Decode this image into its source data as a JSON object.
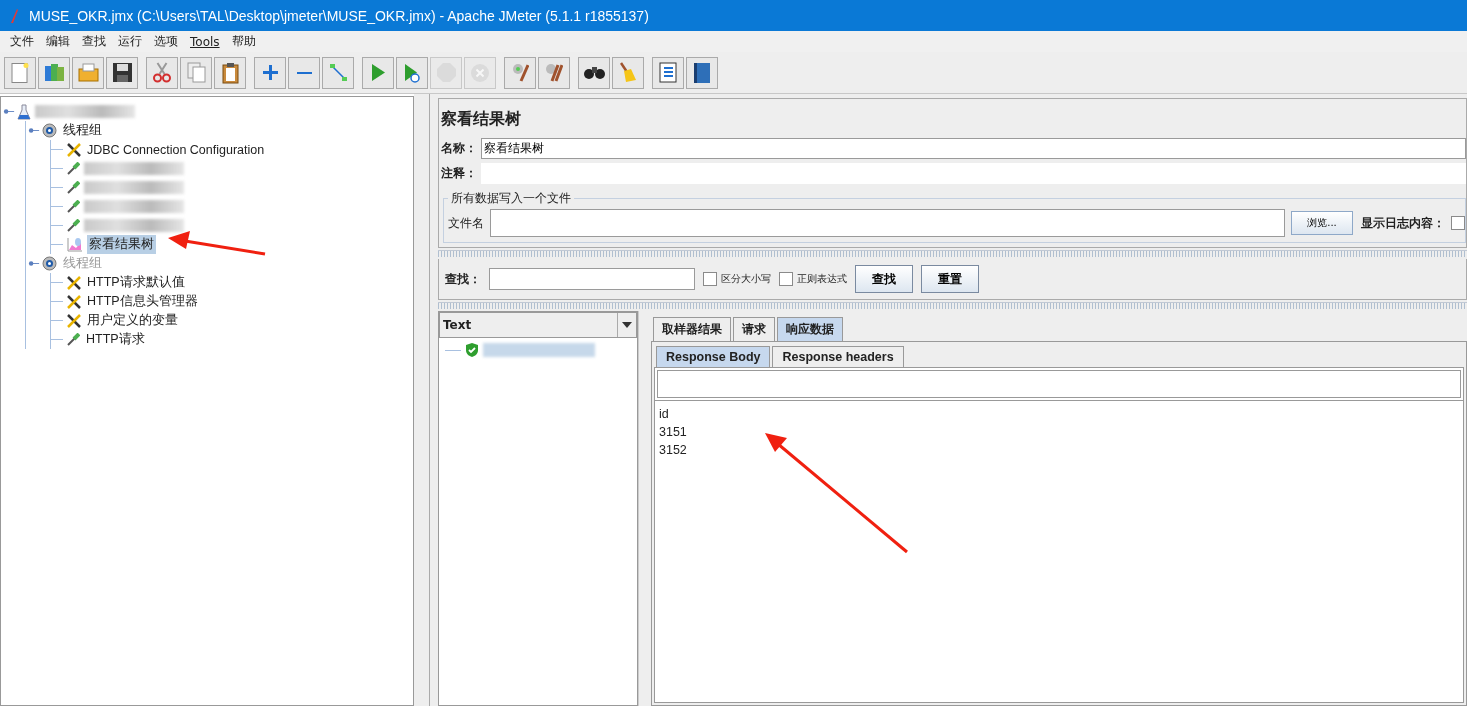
{
  "window": {
    "title": "MUSE_OKR.jmx (C:\\Users\\TAL\\Desktop\\jmeter\\MUSE_OKR.jmx) - Apache JMeter (5.1.1 r1855137)"
  },
  "menu": [
    {
      "label": "文件"
    },
    {
      "label": "编辑"
    },
    {
      "label": "查找"
    },
    {
      "label": "运行"
    },
    {
      "label": "选项"
    },
    {
      "label": "Tools",
      "underline": true
    },
    {
      "label": "帮助"
    }
  ],
  "toolbar": [
    [
      {
        "kind": "new",
        "disabled": false
      },
      {
        "kind": "templates",
        "disabled": false
      },
      {
        "kind": "open",
        "disabled": false
      },
      {
        "kind": "save",
        "disabled": false
      }
    ],
    [
      {
        "kind": "cut",
        "disabled": false
      },
      {
        "kind": "copy",
        "disabled": false
      },
      {
        "kind": "paste",
        "disabled": false
      }
    ],
    [
      {
        "kind": "plus",
        "disabled": false
      },
      {
        "kind": "minus",
        "disabled": false
      },
      {
        "kind": "toggle",
        "disabled": false
      }
    ],
    [
      {
        "kind": "start",
        "disabled": false
      },
      {
        "kind": "startnp",
        "disabled": false
      },
      {
        "kind": "stop",
        "disabled": true
      },
      {
        "kind": "shutdown",
        "disabled": true
      }
    ],
    [
      {
        "kind": "clear",
        "disabled": false
      },
      {
        "kind": "clearall",
        "disabled": false
      }
    ],
    [
      {
        "kind": "binoculars",
        "disabled": false
      },
      {
        "kind": "broom",
        "disabled": false
      }
    ],
    [
      {
        "kind": "list",
        "disabled": false
      },
      {
        "kind": "help",
        "disabled": false
      }
    ]
  ],
  "tree": [
    {
      "kind": "flask",
      "selected": false,
      "disabled": false,
      "expanded": true,
      "children": [
        {
          "kind": "gear",
          "label": "线程组",
          "selected": false,
          "disabled": false,
          "expanded": true,
          "children": [
            {
              "kind": "wrench",
              "label": "JDBC Connection Configuration",
              "selected": false,
              "disabled": false
            },
            {
              "kind": "pipette",
              "selected": false,
              "disabled": false
            },
            {
              "kind": "pipette",
              "selected": false,
              "disabled": false
            },
            {
              "kind": "pipette",
              "selected": false,
              "disabled": false
            },
            {
              "kind": "pipette",
              "selected": false,
              "disabled": false
            },
            {
              "kind": "graph",
              "label": "察看结果树",
              "selected": true,
              "disabled": false
            }
          ]
        },
        {
          "kind": "gear",
          "label": "线程组",
          "selected": false,
          "disabled": true,
          "expanded": true,
          "children": [
            {
              "kind": "wrench",
              "label": "HTTP请求默认值",
              "selected": false,
              "disabled": false
            },
            {
              "kind": "wrench",
              "label": "HTTP信息头管理器",
              "selected": false,
              "disabled": false
            },
            {
              "kind": "wrench",
              "label": "用户定义的变量",
              "selected": false,
              "disabled": false
            },
            {
              "kind": "pipette",
              "label": "HTTP请求",
              "selected": false,
              "disabled": false
            }
          ]
        }
      ]
    }
  ],
  "panel": {
    "title": "察看结果树",
    "name_label": "名称：",
    "name_value": "察看结果树",
    "comment_label": "注释：",
    "file_group": {
      "title": "所有数据写入一个文件",
      "filename_label": "文件名",
      "browse_button": "浏览...",
      "log_label": "显示日志内容：",
      "log_checked": false
    },
    "search": {
      "label": "查找：",
      "options": [
        {
          "label": "区分大小写",
          "checked": false
        },
        {
          "label": "正则表达式",
          "checked": false
        }
      ],
      "buttons": [
        {
          "label": "查找"
        },
        {
          "label": "重置"
        }
      ]
    },
    "renderer": "Text",
    "results": [
      {
        "kind": "success",
        "selected": true
      }
    ],
    "tabs": [
      {
        "label": "取样器结果",
        "selected": false
      },
      {
        "label": "请求",
        "selected": false
      },
      {
        "label": "响应数据",
        "selected": true
      }
    ],
    "subtabs": [
      {
        "label": "Response Body",
        "selected": true
      },
      {
        "label": "Response headers",
        "selected": false
      }
    ],
    "body_lines": [
      "id",
      "3151",
      "3152"
    ]
  },
  "annotations": [
    {
      "kind": "arrow"
    },
    {
      "kind": "arrow"
    }
  ]
}
